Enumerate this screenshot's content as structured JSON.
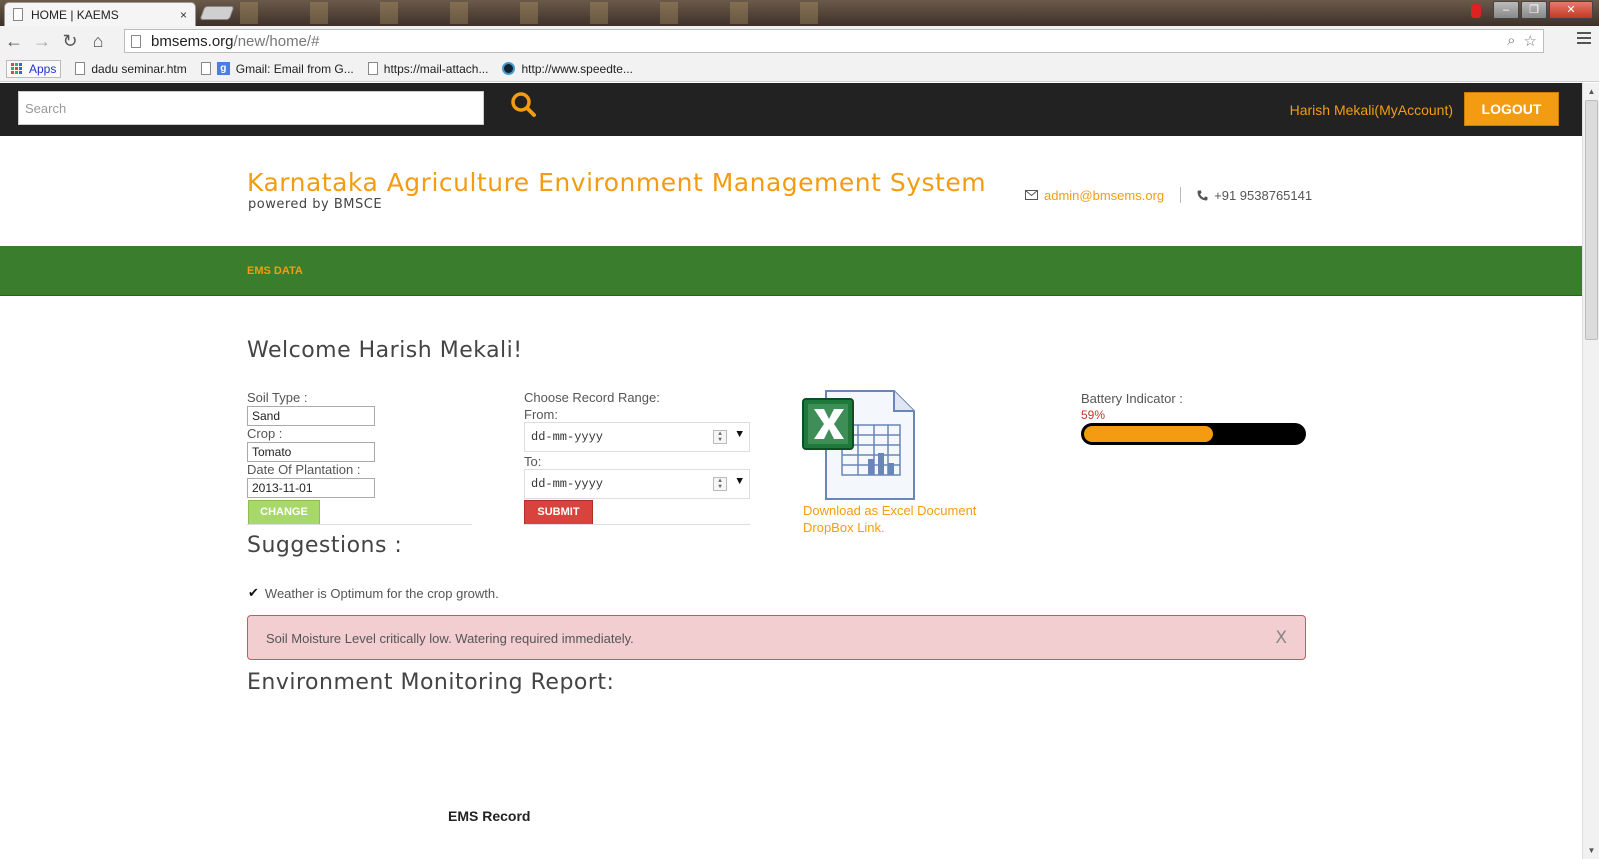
{
  "browser": {
    "tab_title": "HOME | KAEMS",
    "tab_close": "×",
    "url_host": "bmsems.org",
    "url_path": "/new/home/#",
    "bookmarks": [
      {
        "label": "Apps"
      },
      {
        "label": "dadu seminar.htm"
      },
      {
        "label": "Gmail: Email from G..."
      },
      {
        "label": "https://mail-attach..."
      },
      {
        "label": "http://www.speedte..."
      }
    ],
    "google_glyph": "g"
  },
  "topbar": {
    "search_placeholder": "Search",
    "account_label": "Harish Mekali(MyAccount)",
    "logout_label": "LOGOUT"
  },
  "header": {
    "title": "Karnataka Agriculture Environment Management System",
    "subtitle": "powered by BMSCE",
    "email": "admin@bmsems.org",
    "phone": "+91 9538765141"
  },
  "nav": {
    "items": [
      {
        "label": "EMS DATA"
      }
    ]
  },
  "main": {
    "welcome": "Welcome Harish Mekali!",
    "crop_form": {
      "soil_type_label": "Soil Type :",
      "soil_type_value": "Sand",
      "crop_label": "Crop :",
      "crop_value": "Tomato",
      "plantation_label": "Date Of Plantation :",
      "plantation_value": "2013-11-01",
      "change_label": "CHANGE"
    },
    "range_form": {
      "title": "Choose Record Range:",
      "from_label": "From:",
      "from_value": "dd-mm-yyyy",
      "to_label": "To:",
      "to_value": "dd-mm-yyyy",
      "submit_label": "SUBMIT"
    },
    "download": {
      "excel_label": "Download as Excel Document",
      "dropbox_label": "DropBox Link."
    },
    "battery": {
      "label": "Battery Indicator :",
      "percent_text": "59%",
      "level": 0.59
    },
    "suggestions": {
      "title": "Suggestions :",
      "items": [
        {
          "text": "Weather is Optimum for the crop growth."
        }
      ]
    },
    "alert": {
      "text": "Soil Moisture Level critically low. Watering required immediately.",
      "close": "X"
    },
    "report_title": "Environment Monitoring Report:",
    "ems_record": "EMS Record"
  },
  "colors": {
    "accent": "#f39c12",
    "nav_green": "#3a7d2c",
    "topbar": "#222222",
    "alert_bg": "#f2ced1",
    "submit_red": "#d9433d",
    "change_green": "#a8d86a"
  }
}
